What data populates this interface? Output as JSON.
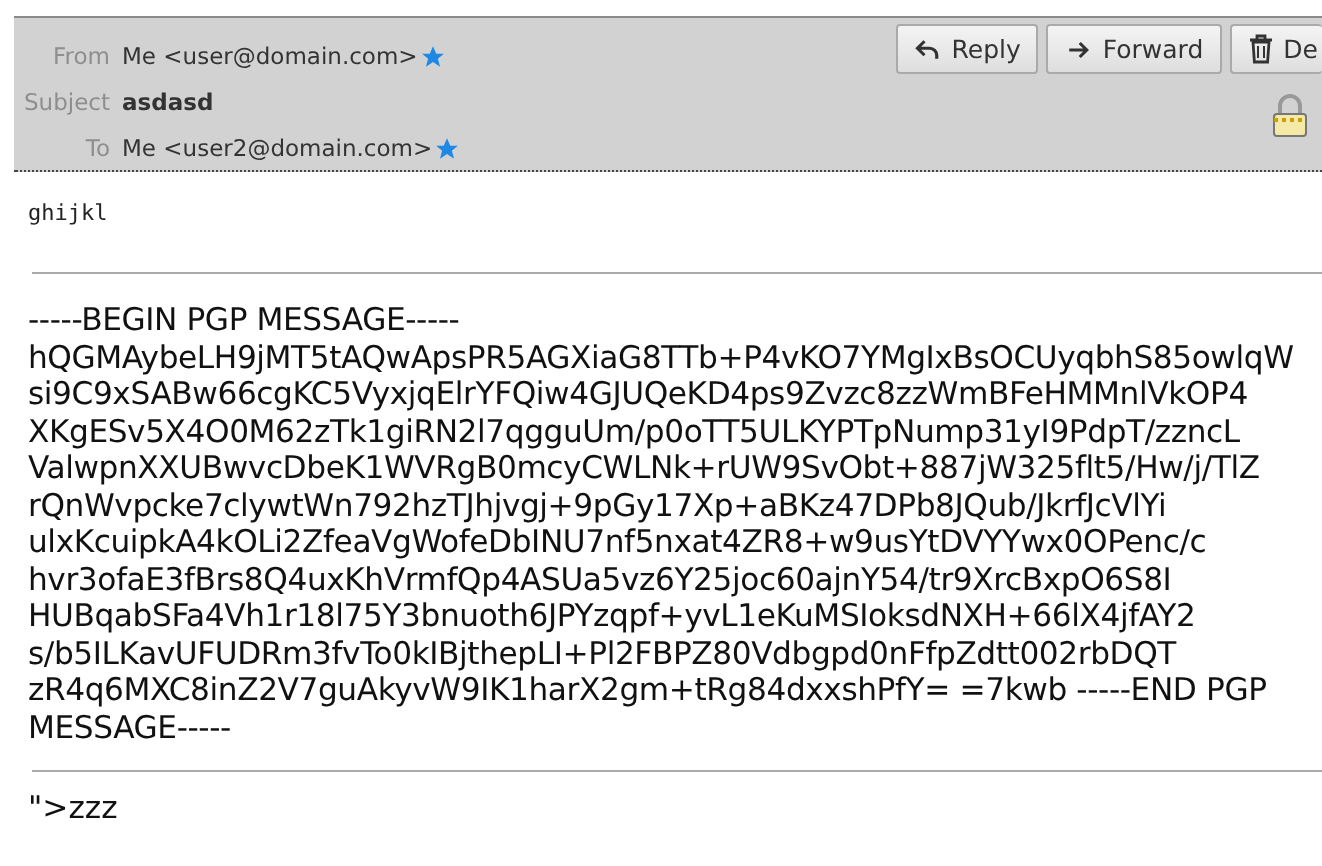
{
  "header": {
    "fields": [
      {
        "label": "From",
        "value": "Me <user@domain.com>",
        "starred": true,
        "kind": "address"
      },
      {
        "label": "Subject",
        "value": "asdasd",
        "starred": false,
        "kind": "subject"
      },
      {
        "label": "To",
        "value": "Me <user2@domain.com>",
        "starred": true,
        "kind": "address"
      }
    ],
    "buttons": [
      {
        "label": "Reply",
        "kind": "reply"
      },
      {
        "label": "Forward",
        "kind": "forward"
      },
      {
        "label": "De",
        "kind": "delete"
      }
    ],
    "encrypted": true
  },
  "body": {
    "preamble": "ghijkl",
    "pgp_lines": [
      "-----BEGIN PGP MESSAGE-----",
      "hQGMAybeLH9jMT5tAQwApsPR5AGXiaG8TTb+P4vKO7YMgIxBsOCUyqbhS85owlqW",
      "si9C9xSABw66cgKC5VyxjqElrYFQiw4GJUQeKD4ps9Zvzc8zzWmBFeHMMnlVkOP4",
      "XKgESv5X4O0M62zTk1giRN2l7qgguUm/p0oTT5ULKYPTpNump31yI9PdpT/zzncL",
      "ValwpnXXUBwvcDbeK1WVRgB0mcyCWLNk+rUW9SvObt+887jW325flt5/Hw/j/TlZ",
      "rQnWvpcke7clywtWn792hzTJhjvgj+9pGy17Xp+aBKz47DPb8JQub/JkrfJcVlYi",
      "ulxKcuipkA4kOLi2ZfeaVgWofeDbINU7nf5nxat4ZR8+w9usYtDVYYwx0OPenc/c",
      "hvr3ofaE3fBrs8Q4uxKhVrmfQp4ASUa5vz6Y25joc60ajnY54/tr9XrcBxpO6S8I",
      "HUBqabSFa4Vh1r18l75Y3bnuoth6JPYzqpf+yvL1eKuMSIoksdNXH+66lX4jfAY2",
      "s/b5ILKavUFUDRm3fvTo0kIBjthepLI+Pl2FBPZ80Vdbgpd0nFfpZdtt002rbDQT",
      "zR4q6MXC8inZ2V7guAkyvW9IK1harX2gm+tRg84dxxshPfY= =7kwb -----END PGP",
      "MESSAGE-----"
    ],
    "footer": "\">zzz"
  }
}
